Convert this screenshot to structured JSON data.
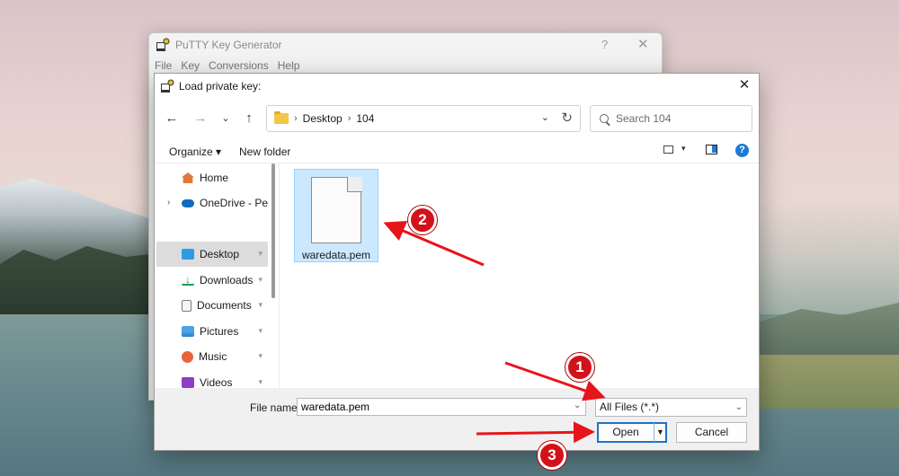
{
  "putty": {
    "title": "PuTTY Key Generator",
    "help_glyph": "?",
    "close_glyph": "✕",
    "menu": [
      "File",
      "Key",
      "Conversions",
      "Help"
    ]
  },
  "dialog": {
    "title": "Load private key:",
    "close_glyph": "✕"
  },
  "navigation": {
    "back_glyph": "←",
    "forward_glyph": "→",
    "recent_glyph": "⌄",
    "up_glyph": "↑",
    "breadcrumb": [
      "Desktop",
      "104"
    ],
    "breadcrumb_sep": "›",
    "dropdown_glyph": "⌄",
    "refresh_glyph": "↻",
    "search_placeholder": "Search 104"
  },
  "commandbar": {
    "organize": "Organize ▾",
    "new_folder": "New folder",
    "view_dd_glyph": "▾",
    "help_glyph": "?"
  },
  "sidebar": {
    "pin_glyph": "📌",
    "expand_glyph": "›",
    "items": [
      {
        "label": "Home",
        "icon": "home-icon"
      },
      {
        "label": "OneDrive - Personal",
        "icon": "onedrive-icon"
      },
      {
        "label": "Desktop",
        "icon": "desktop-icon"
      },
      {
        "label": "Downloads",
        "icon": "download-icon"
      },
      {
        "label": "Documents",
        "icon": "document-icon"
      },
      {
        "label": "Pictures",
        "icon": "pictures-icon"
      },
      {
        "label": "Music",
        "icon": "music-icon"
      },
      {
        "label": "Videos",
        "icon": "videos-icon"
      }
    ]
  },
  "files": [
    {
      "name": "waredata.pem",
      "icon": "file-icon",
      "selected": true
    }
  ],
  "footer": {
    "file_name_label": "File name:",
    "file_name_value": "waredata.pem",
    "file_type": "All Files (*.*)",
    "dropdown_glyph": "⌄",
    "open_label": "Open",
    "open_split_glyph": "▼",
    "cancel_label": "Cancel"
  },
  "annotations": {
    "badges": [
      "1",
      "2",
      "3"
    ],
    "color": "#d2121a"
  }
}
